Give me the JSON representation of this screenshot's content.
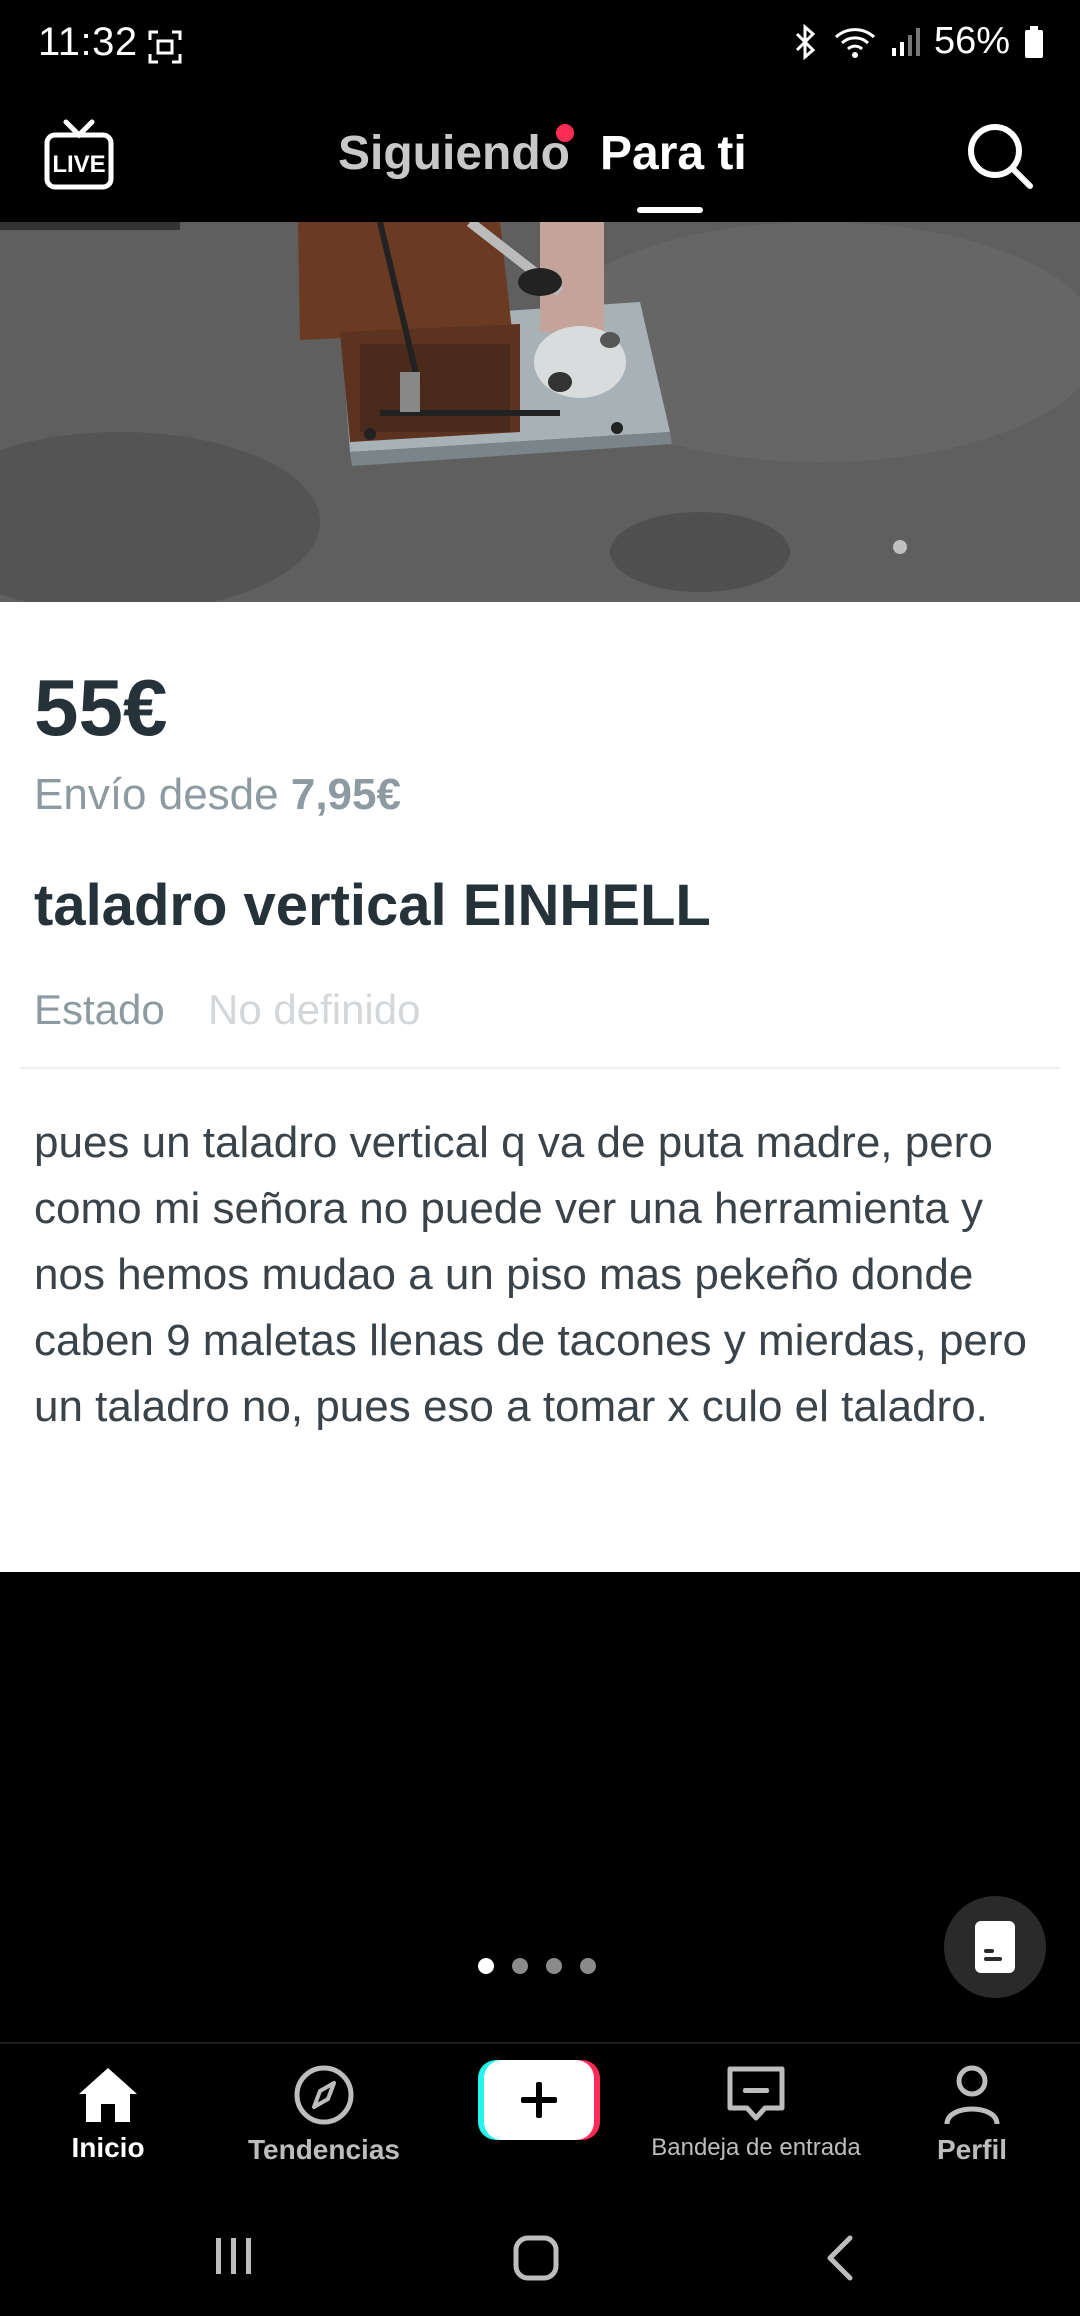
{
  "status_bar": {
    "time": "11:32",
    "battery": "56%"
  },
  "top_nav": {
    "following_tab": "Siguiendo",
    "for_you_tab": "Para ti",
    "live_label": "LIVE"
  },
  "listing": {
    "price": "55€",
    "shipping_prefix": "Envío desde",
    "shipping_price": "7,95€",
    "title": "taladro vertical EINHELL",
    "state_label": "Estado",
    "state_value": "No definido",
    "description": "pues un taladro vertical q va de puta madre, pero como mi señora no puede ver una herramienta y nos hemos mudao a un piso mas pekeño donde caben 9 maletas llenas de tacones y mierdas, pero un taladro no, pues eso a tomar x culo el taladro."
  },
  "carousel": {
    "total": 4,
    "active_index": 1
  },
  "bottom_nav": {
    "home": "Inicio",
    "trending": "Tendencias",
    "inbox": "Bandeja de entrada",
    "profile": "Perfil"
  },
  "colors": {
    "accent_red": "#fe2c55",
    "create_cyan": "#25f4ee",
    "price_text": "#26323a",
    "muted_text": "#8e9aa1"
  }
}
